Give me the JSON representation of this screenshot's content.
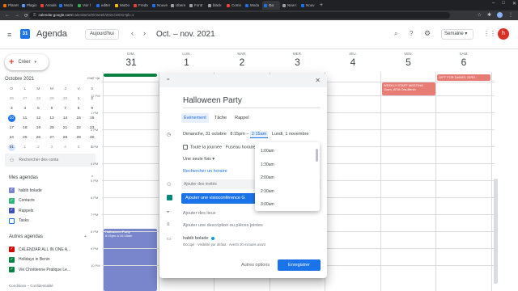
{
  "browser": {
    "tabs": [
      {
        "label": "Planet",
        "color": "#e8710a"
      },
      {
        "label": "Plagio",
        "color": "#5e97f6"
      },
      {
        "label": "Annals",
        "color": "#ea4335"
      },
      {
        "label": "Modu",
        "color": "#1a73e8"
      },
      {
        "label": "Voir l",
        "color": "#34a853"
      },
      {
        "label": "editer",
        "color": "#1a73e8"
      },
      {
        "label": "MoDo",
        "color": "#fbbc04"
      },
      {
        "label": "Freda",
        "color": "#ea4335"
      },
      {
        "label": "Nouve",
        "color": "#1a73e8"
      },
      {
        "label": "Ubere",
        "color": "#9aa0a6"
      },
      {
        "label": "Fontr",
        "color": "#9aa0a6"
      },
      {
        "label": "black",
        "color": "#9aa0a6"
      },
      {
        "label": "Comn",
        "color": "#ea4335"
      },
      {
        "label": "Modu",
        "color": "#1a73e8"
      },
      {
        "label": "Go",
        "color": "#1a73e8",
        "active": true
      },
      {
        "label": "New t",
        "color": "#9aa0a6"
      },
      {
        "label": "Nouv",
        "color": "#1a73e8"
      }
    ],
    "new_tab": "+",
    "url_host": "calendar.google.com",
    "url_path": "/calendar/u/0/r/week/2021/10/31?pli=1",
    "back": "←",
    "forward": "→",
    "reload": "⟳",
    "lock": "🔒",
    "minimize": "–",
    "maximize": "□",
    "close": "✕",
    "star": "☆",
    "puzzle": "✱",
    "menu": "⋮"
  },
  "header": {
    "menu_icon": "≡",
    "logo_text": "31",
    "app_title": "Agenda",
    "today_label": "Aujourd'hui",
    "prev": "‹",
    "next": "›",
    "period": "Oct. – nov. 2021",
    "search_icon": "⌕",
    "help_icon": "?",
    "settings_icon": "⚙",
    "view_label": "Semaine",
    "view_caret": "▾",
    "apps_icon": "⋮⋮",
    "avatar_letter": "h"
  },
  "sidebar": {
    "create_plus": "+",
    "create_label": "Créer",
    "create_caret": "▾",
    "mini_month": "Octobre 2021",
    "mini_prev": "‹",
    "mini_next": "›",
    "dow": [
      "D",
      "L",
      "M",
      "M",
      "J",
      "V",
      "S"
    ],
    "weeks": [
      [
        "26",
        "27",
        "28",
        "29",
        "30",
        "1",
        "2"
      ],
      [
        "3",
        "4",
        "5",
        "6",
        "7",
        "8",
        "9"
      ],
      [
        "10",
        "11",
        "12",
        "13",
        "14",
        "15",
        "16"
      ],
      [
        "17",
        "18",
        "19",
        "20",
        "21",
        "22",
        "23"
      ],
      [
        "24",
        "25",
        "26",
        "27",
        "28",
        "29",
        "30"
      ],
      [
        "31",
        "1",
        "2",
        "3",
        "4",
        "5",
        "6"
      ]
    ],
    "people_icon": "👥",
    "people_placeholder": "Rechercher des conta",
    "my_calendars_title": "Mes agendas",
    "my_calendars": [
      {
        "label": "habib bolade",
        "color": "#7986cb",
        "checked": true
      },
      {
        "label": "Contacts",
        "color": "#33b679",
        "checked": true
      },
      {
        "label": "Rappels",
        "color": "#3f51b5",
        "checked": true
      },
      {
        "label": "Tasks",
        "color": "#1a73e8",
        "checked": false
      }
    ],
    "other_calendars_title": "Autres agendas",
    "other_add": "+",
    "other_calendars": [
      {
        "label": "CALENDAR ALL IN ONE A...",
        "color": "#d50000",
        "checked": true
      },
      {
        "label": "Holidays in Benin",
        "color": "#0b8043",
        "checked": true
      },
      {
        "label": "Vie Chrétienne Pratique Le...",
        "color": "#0b8043",
        "checked": true
      }
    ],
    "section_caret": "^",
    "footer": "Conditions – Confidentialité"
  },
  "week": {
    "tz": "GMT+01",
    "days": [
      {
        "name": "DIM.",
        "num": "31"
      },
      {
        "name": "LUN.",
        "num": "1"
      },
      {
        "name": "MAR.",
        "num": "2"
      },
      {
        "name": "MER.",
        "num": "3"
      },
      {
        "name": "JEU.",
        "num": "4"
      },
      {
        "name": "VEN.",
        "num": "5"
      },
      {
        "name": "SAM.",
        "num": "6"
      }
    ],
    "times": [
      "12 PM",
      "1 PM",
      "2 PM",
      "3 PM",
      "4 PM",
      "5 PM",
      "6 PM",
      "7 PM",
      "8 PM",
      "9 PM",
      "10 PM"
    ],
    "allday_green": "",
    "sat_event": "GIFT FOR DANIEL GIRD...",
    "fri_event_title": "WEEKLY STAFF MEETING",
    "fri_event_sub": "11am, AFIA Ora-Benin",
    "sun_event_title": "Halloween Party",
    "sun_event_time": "8:15pm à 10:15am",
    "colors": {
      "blue": "#7986cb",
      "red": "#e67c73",
      "green": "#0b8043"
    }
  },
  "modal": {
    "drag_icon": "=",
    "close_icon": "✕",
    "title": "Halloween Party",
    "tabs": [
      {
        "label": "Événement",
        "active": true
      },
      {
        "label": "Tâche",
        "active": false
      },
      {
        "label": "Rappel",
        "active": false
      }
    ],
    "clock_icon": "◷",
    "start_date": "Dimanche, 31 octobre",
    "start_time": "8:15pm",
    "dash": "–",
    "end_time": "2:15am",
    "end_date": "Lundi, 1 novembre",
    "allday_label": "Toute la journée",
    "timezone_label": "Fuseau horaire",
    "repeat_label": "Une seule fois",
    "repeat_caret": "▾",
    "find_time": "Rechercher un horaire",
    "guests_icon": "👤",
    "guests_placeholder": "Ajouter des invités",
    "meet_label": "Ajouter une visioconférence G",
    "location_icon": "⌖",
    "location_label": "Ajouter des lieux",
    "desc_icon": "≡",
    "desc_label": "Ajouter une description ou pièces jointes",
    "cal_icon": "▭",
    "organizer": "habib bolade",
    "organizer_meta": "Occupé · Visibilité par défaut · Avertir 30 minutes avant",
    "more_options": "Autres options",
    "save": "Enregistrer"
  },
  "dropdown": {
    "options": [
      "1:00am",
      "1:30am",
      "2:00am",
      "2:30am",
      "3:00am"
    ]
  }
}
